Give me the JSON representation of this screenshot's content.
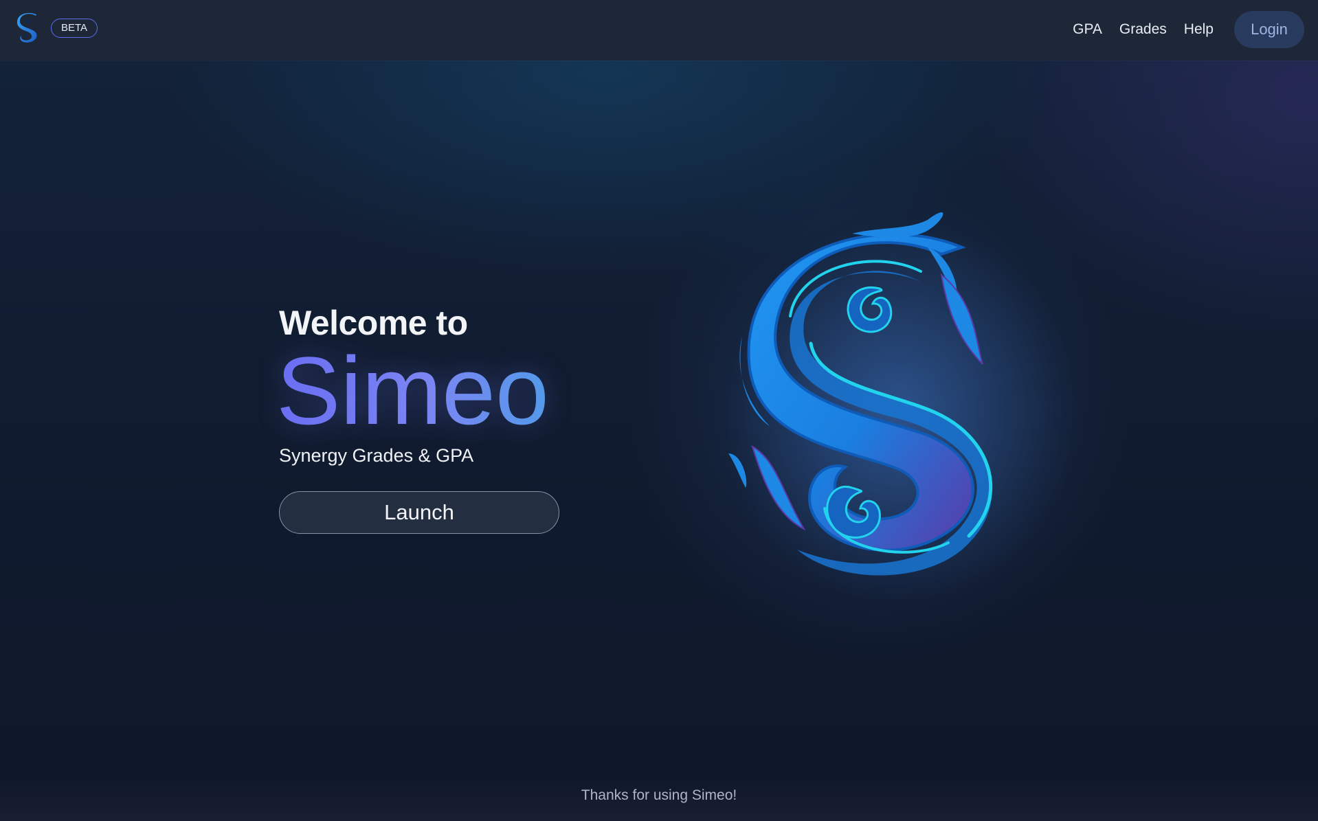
{
  "header": {
    "logo_icon": "simeo-s-icon",
    "badge": "BETA",
    "nav": [
      "GPA",
      "Grades",
      "Help"
    ],
    "login_label": "Login"
  },
  "hero": {
    "welcome": "Welcome to",
    "brand": "Simeo",
    "tagline": "Synergy Grades & GPA",
    "launch_label": "Launch",
    "emblem_icon": "simeo-s-emblem"
  },
  "footer": {
    "text": "Thanks for using Simeo!"
  },
  "colors": {
    "accent": "#6a6ef2",
    "brand_blue": "#1e88e5",
    "cyan_highlight": "#22d3ee",
    "nav_bg": "#1e2738"
  }
}
